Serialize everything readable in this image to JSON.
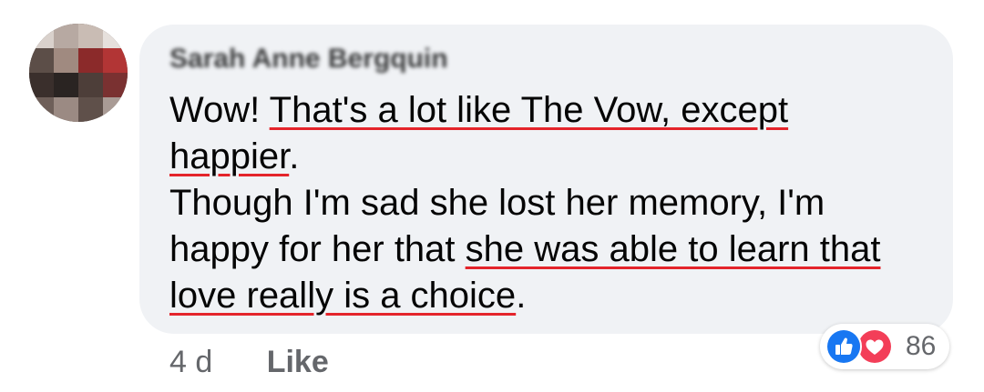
{
  "comment": {
    "author_name": "Sarah Anne Bergquin",
    "lines": [
      [
        {
          "text": "Wow! ",
          "underlined": false
        },
        {
          "text": "That's a lot like The Vow, except",
          "underlined": true
        }
      ],
      [
        {
          "text": "happier",
          "underlined": true
        },
        {
          "text": ".",
          "underlined": false
        }
      ],
      [
        {
          "text": "Though I'm sad she lost her memory, I'm",
          "underlined": false
        }
      ],
      [
        {
          "text": "happy for her that ",
          "underlined": false
        },
        {
          "text": "she was able to learn that",
          "underlined": true
        }
      ],
      [
        {
          "text": "love really is a choice",
          "underlined": true
        },
        {
          "text": ".",
          "underlined": false
        }
      ]
    ],
    "timestamp": "4 d",
    "like_label": "Like",
    "reactions": {
      "icons": [
        "like-icon",
        "love-icon"
      ],
      "count": "86"
    }
  },
  "colors": {
    "bubble_background": "#f0f2f5",
    "text": "#050505",
    "secondary_text": "#65676b",
    "underline": "#e4242b",
    "like_blue": "#1877f2",
    "love_red": "#f33e58"
  }
}
